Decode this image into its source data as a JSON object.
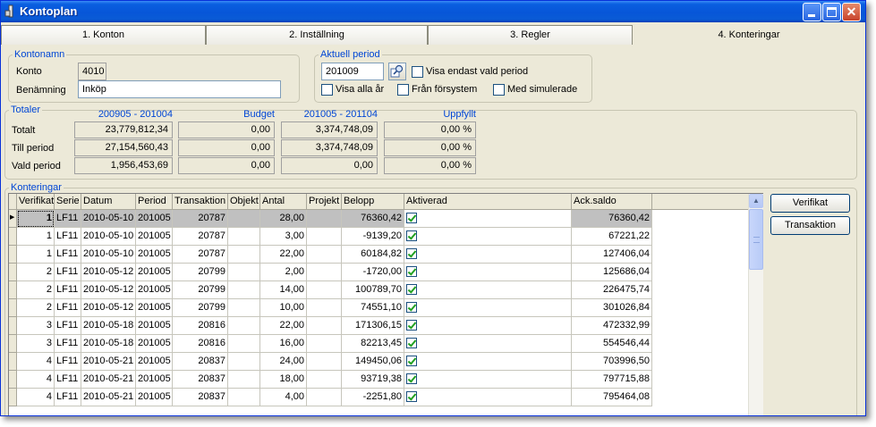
{
  "window": {
    "title": "Kontoplan"
  },
  "tabs": [
    {
      "label": "1. Konton"
    },
    {
      "label": "2. Inställning"
    },
    {
      "label": "3. Regler"
    },
    {
      "label": "4. Konteringar"
    }
  ],
  "kontonamn": {
    "legend": "Kontonamn",
    "konto_label": "Konto",
    "konto_value": "4010",
    "benamning_label": "Benämning",
    "benamning_value": "Inköp"
  },
  "aktuell_period": {
    "legend": "Aktuell period",
    "period_value": "201009",
    "visa_endast": {
      "label": "Visa endast vald period",
      "checked": false
    },
    "visa_alla_ar": {
      "label": "Visa alla år",
      "checked": false
    },
    "fran_forsystem": {
      "label": "Från försystem",
      "checked": false
    },
    "med_simulerade": {
      "label": "Med simulerade",
      "checked": false
    }
  },
  "totaler": {
    "legend": "Totaler",
    "col_headers": [
      "200905 - 201004",
      "Budget",
      "201005 - 201104",
      "Uppfyllt"
    ],
    "rows": [
      {
        "label": "Totalt",
        "values": [
          "23,779,812,34",
          "0,00",
          "3,374,748,09",
          "0,00 %"
        ]
      },
      {
        "label": "Till period",
        "values": [
          "27,154,560,43",
          "0,00",
          "3,374,748,09",
          "0,00 %"
        ]
      },
      {
        "label": "Vald period",
        "values": [
          "1,956,453,69",
          "0,00",
          "0,00",
          "0,00 %"
        ]
      }
    ]
  },
  "konteringar": {
    "legend": "Konteringar",
    "columns": [
      "Verifikat",
      "Serie",
      "Datum",
      "Period",
      "Transaktion",
      "Objekt",
      "Antal",
      "Projekt",
      "Belopp",
      "Aktiverad",
      "Ack.saldo"
    ],
    "rows": [
      {
        "verifikat": "1",
        "serie": "LF11",
        "datum": "2010-05-10",
        "period": "201005",
        "transaktion": "20787",
        "objekt": "",
        "antal": "28,00",
        "projekt": "",
        "belopp": "76360,42",
        "aktiverad": true,
        "ack_saldo": "76360,42"
      },
      {
        "verifikat": "1",
        "serie": "LF11",
        "datum": "2010-05-10",
        "period": "201005",
        "transaktion": "20787",
        "objekt": "",
        "antal": "3,00",
        "projekt": "",
        "belopp": "-9139,20",
        "aktiverad": true,
        "ack_saldo": "67221,22"
      },
      {
        "verifikat": "1",
        "serie": "LF11",
        "datum": "2010-05-10",
        "period": "201005",
        "transaktion": "20787",
        "objekt": "",
        "antal": "22,00",
        "projekt": "",
        "belopp": "60184,82",
        "aktiverad": true,
        "ack_saldo": "127406,04"
      },
      {
        "verifikat": "2",
        "serie": "LF11",
        "datum": "2010-05-12",
        "period": "201005",
        "transaktion": "20799",
        "objekt": "",
        "antal": "2,00",
        "projekt": "",
        "belopp": "-1720,00",
        "aktiverad": true,
        "ack_saldo": "125686,04"
      },
      {
        "verifikat": "2",
        "serie": "LF11",
        "datum": "2010-05-12",
        "period": "201005",
        "transaktion": "20799",
        "objekt": "",
        "antal": "14,00",
        "projekt": "",
        "belopp": "100789,70",
        "aktiverad": true,
        "ack_saldo": "226475,74"
      },
      {
        "verifikat": "2",
        "serie": "LF11",
        "datum": "2010-05-12",
        "period": "201005",
        "transaktion": "20799",
        "objekt": "",
        "antal": "10,00",
        "projekt": "",
        "belopp": "74551,10",
        "aktiverad": true,
        "ack_saldo": "301026,84"
      },
      {
        "verifikat": "3",
        "serie": "LF11",
        "datum": "2010-05-18",
        "period": "201005",
        "transaktion": "20816",
        "objekt": "",
        "antal": "22,00",
        "projekt": "",
        "belopp": "171306,15",
        "aktiverad": true,
        "ack_saldo": "472332,99"
      },
      {
        "verifikat": "3",
        "serie": "LF11",
        "datum": "2010-05-18",
        "period": "201005",
        "transaktion": "20816",
        "objekt": "",
        "antal": "16,00",
        "projekt": "",
        "belopp": "82213,45",
        "aktiverad": true,
        "ack_saldo": "554546,44"
      },
      {
        "verifikat": "4",
        "serie": "LF11",
        "datum": "2010-05-21",
        "period": "201005",
        "transaktion": "20837",
        "objekt": "",
        "antal": "24,00",
        "projekt": "",
        "belopp": "149450,06",
        "aktiverad": true,
        "ack_saldo": "703996,50"
      },
      {
        "verifikat": "4",
        "serie": "LF11",
        "datum": "2010-05-21",
        "period": "201005",
        "transaktion": "20837",
        "objekt": "",
        "antal": "18,00",
        "projekt": "",
        "belopp": "93719,38",
        "aktiverad": true,
        "ack_saldo": "797715,88"
      },
      {
        "verifikat": "4",
        "serie": "LF11",
        "datum": "2010-05-21",
        "period": "201005",
        "transaktion": "20837",
        "objekt": "",
        "antal": "4,00",
        "projekt": "",
        "belopp": "-2251,80",
        "aktiverad": true,
        "ack_saldo": "795464,08"
      }
    ],
    "selected_row": 0
  },
  "buttons": {
    "verifikat": "Verifikat",
    "transaktion": "Transaktion"
  }
}
